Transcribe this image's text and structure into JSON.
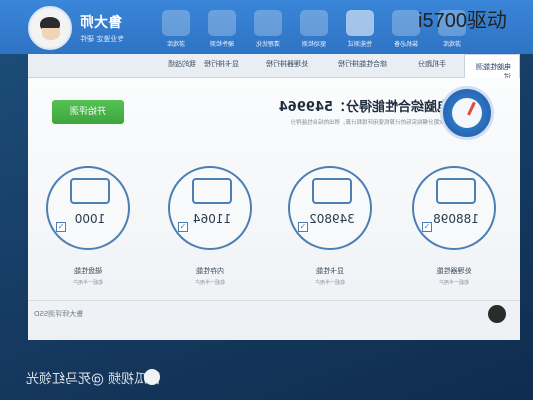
{
  "app": {
    "title": "鲁大师",
    "subtitle": "专业鉴定 硬件"
  },
  "overlay": {
    "caption": "i5700驱动"
  },
  "nav": {
    "items": [
      {
        "label": "游戏库",
        "icon": "gamepad-icon"
      },
      {
        "label": "硬件检测",
        "icon": "pc-icon"
      },
      {
        "label": "清理优化",
        "icon": "broom-icon"
      },
      {
        "label": "驱动检测",
        "icon": "driver-icon"
      },
      {
        "label": "性能测试",
        "icon": "speedometer-icon",
        "active": true
      },
      {
        "label": "装机必备",
        "icon": "box-icon"
      },
      {
        "label": "游戏库",
        "icon": "grid-icon"
      }
    ]
  },
  "tabs": [
    {
      "label": "电脑性能测试",
      "active": true
    },
    {
      "label": "手机跑分"
    },
    {
      "label": "综合性能排行榜"
    },
    {
      "label": "处理器排行榜"
    },
    {
      "label": "显卡排行榜"
    },
    {
      "label": "我的战绩"
    }
  ],
  "main": {
    "start_button": "开始评测",
    "score_label": "电脑综合性能得分：",
    "score_value": "549964",
    "score_desc": "本次跑分模拟实际的计算机使用环境和计算，得出的综合性能得分"
  },
  "hardware": [
    {
      "name": "处理器性能",
      "value": "188098",
      "sub": "稳超一半用户",
      "icon": "monitor-icon"
    },
    {
      "name": "显卡性能",
      "value": "349802",
      "sub": "稳超一半用户",
      "icon": "gpu-icon"
    },
    {
      "name": "内存性能",
      "value": "11064",
      "sub": "稳超一半用户",
      "icon": "ram-icon"
    },
    {
      "name": "磁盘性能",
      "value": "1000",
      "sub": "稳超一半用户",
      "icon": "disk-icon"
    }
  ],
  "footer": {
    "left_text": "鲁大师评测SSD"
  },
  "watermark": {
    "text": "西瓜视频 @死马红领光"
  }
}
